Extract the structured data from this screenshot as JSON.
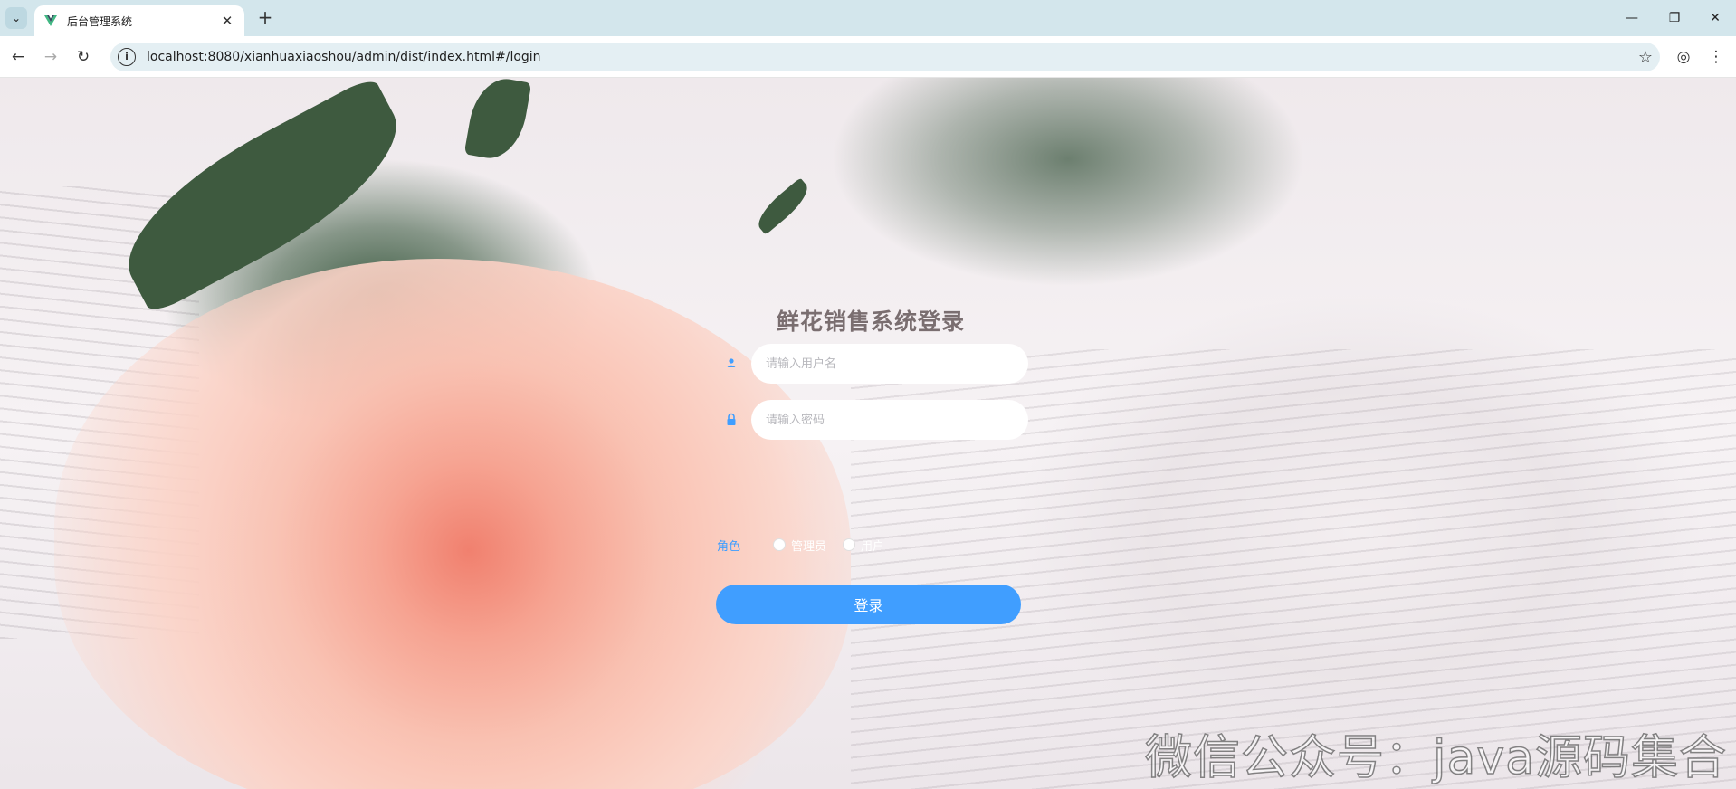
{
  "browser": {
    "tab_title": "后台管理系统",
    "url": "localhost:8080/xianhuaxiaoshou/admin/dist/index.html#/login",
    "site_info_glyph": "i",
    "icons": {
      "tab_list": "chevron-down-icon",
      "favicon": "vue-logo-icon",
      "close_tab": "close-icon",
      "new_tab": "plus-icon",
      "back": "arrow-left-icon",
      "forward": "arrow-right-icon",
      "reload": "reload-icon",
      "bookmark": "star-icon",
      "profile": "account-circle-icon",
      "menu": "more-vertical-icon",
      "minimize": "minimize-icon",
      "restore": "restore-icon",
      "close_window": "close-icon"
    },
    "glyphs": {
      "tab_list": "⌄",
      "close_tab": "✕",
      "new_tab": "+",
      "back": "←",
      "forward": "→",
      "reload": "↻",
      "bookmark": "☆",
      "profile": "◎",
      "menu": "⋮",
      "minimize": "—",
      "restore": "❐",
      "close_window": "✕"
    }
  },
  "login": {
    "title": "鲜花销售系统登录",
    "username_placeholder": "请输入用户名",
    "password_placeholder": "请输入密码",
    "role_label": "角色",
    "roles": [
      {
        "label": "管理员",
        "selected": false
      },
      {
        "label": "用户",
        "selected": false
      }
    ],
    "submit_label": "登录",
    "user_icon": "user-icon",
    "lock_icon": "lock-icon"
  },
  "watermark": "微信公众号：java源码集合",
  "colors": {
    "accent": "#409eff",
    "tabbar": "#d3e6ec",
    "omnibox": "#e4eff3"
  }
}
